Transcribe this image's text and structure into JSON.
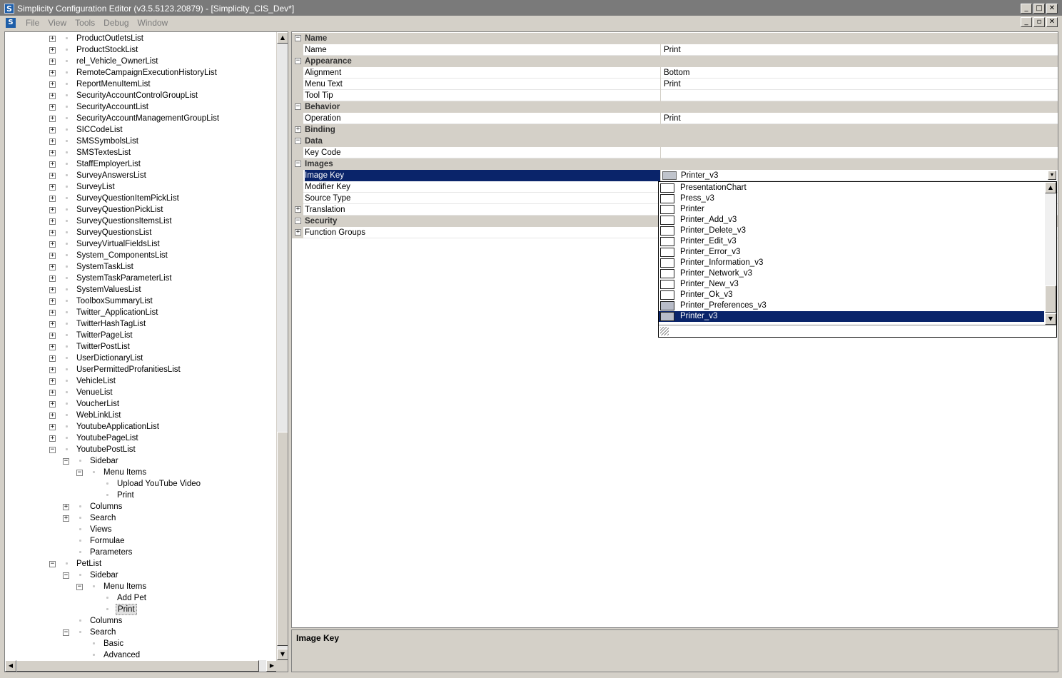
{
  "window": {
    "title": "Simplicity Configuration Editor (v3.5.5123.20879) - [Simplicity_CIS_Dev*]",
    "icon_letter": "S",
    "controls": [
      "_",
      "□",
      "✕"
    ],
    "mdi_controls": [
      "_",
      "▫",
      "✕"
    ]
  },
  "menu": [
    "File",
    "View",
    "Tools",
    "Debug",
    "Window"
  ],
  "tree": [
    {
      "label": "ProductOutletsList",
      "level": 0,
      "state": "collapsed"
    },
    {
      "label": "ProductStockList",
      "level": 0,
      "state": "collapsed"
    },
    {
      "label": "rel_Vehicle_OwnerList",
      "level": 0,
      "state": "collapsed"
    },
    {
      "label": "RemoteCampaignExecutionHistoryList",
      "level": 0,
      "state": "collapsed"
    },
    {
      "label": "ReportMenuItemList",
      "level": 0,
      "state": "collapsed"
    },
    {
      "label": "SecurityAccountControlGroupList",
      "level": 0,
      "state": "collapsed"
    },
    {
      "label": "SecurityAccountList",
      "level": 0,
      "state": "collapsed"
    },
    {
      "label": "SecurityAccountManagementGroupList",
      "level": 0,
      "state": "collapsed"
    },
    {
      "label": "SICCodeList",
      "level": 0,
      "state": "collapsed"
    },
    {
      "label": "SMSSymbolsList",
      "level": 0,
      "state": "collapsed"
    },
    {
      "label": "SMSTextesList",
      "level": 0,
      "state": "collapsed"
    },
    {
      "label": "StaffEmployerList",
      "level": 0,
      "state": "collapsed"
    },
    {
      "label": "SurveyAnswersList",
      "level": 0,
      "state": "collapsed"
    },
    {
      "label": "SurveyList",
      "level": 0,
      "state": "collapsed"
    },
    {
      "label": "SurveyQuestionItemPickList",
      "level": 0,
      "state": "collapsed"
    },
    {
      "label": "SurveyQuestionPickList",
      "level": 0,
      "state": "collapsed"
    },
    {
      "label": "SurveyQuestionsItemsList",
      "level": 0,
      "state": "collapsed"
    },
    {
      "label": "SurveyQuestionsList",
      "level": 0,
      "state": "collapsed"
    },
    {
      "label": "SurveyVirtualFieldsList",
      "level": 0,
      "state": "collapsed"
    },
    {
      "label": "System_ComponentsList",
      "level": 0,
      "state": "collapsed"
    },
    {
      "label": "SystemTaskList",
      "level": 0,
      "state": "collapsed"
    },
    {
      "label": "SystemTaskParameterList",
      "level": 0,
      "state": "collapsed"
    },
    {
      "label": "SystemValuesList",
      "level": 0,
      "state": "collapsed"
    },
    {
      "label": "ToolboxSummaryList",
      "level": 0,
      "state": "collapsed"
    },
    {
      "label": "Twitter_ApplicationList",
      "level": 0,
      "state": "collapsed"
    },
    {
      "label": "TwitterHashTagList",
      "level": 0,
      "state": "collapsed"
    },
    {
      "label": "TwitterPageList",
      "level": 0,
      "state": "collapsed"
    },
    {
      "label": "TwitterPostList",
      "level": 0,
      "state": "collapsed"
    },
    {
      "label": "UserDictionaryList",
      "level": 0,
      "state": "collapsed"
    },
    {
      "label": "UserPermittedProfanitiesList",
      "level": 0,
      "state": "collapsed"
    },
    {
      "label": "VehicleList",
      "level": 0,
      "state": "collapsed"
    },
    {
      "label": "VenueList",
      "level": 0,
      "state": "collapsed"
    },
    {
      "label": "VoucherList",
      "level": 0,
      "state": "collapsed"
    },
    {
      "label": "WebLinkList",
      "level": 0,
      "state": "collapsed"
    },
    {
      "label": "YoutubeApplicationList",
      "level": 0,
      "state": "collapsed"
    },
    {
      "label": "YoutubePageList",
      "level": 0,
      "state": "collapsed"
    },
    {
      "label": "YoutubePostList",
      "level": 0,
      "state": "expanded"
    },
    {
      "label": "Sidebar",
      "level": 1,
      "state": "expanded"
    },
    {
      "label": "Menu Items",
      "level": 2,
      "state": "expanded"
    },
    {
      "label": "Upload YouTube Video",
      "level": 3,
      "state": "leaf"
    },
    {
      "label": "Print",
      "level": 3,
      "state": "leaf"
    },
    {
      "label": "Columns",
      "level": 1,
      "state": "collapsed"
    },
    {
      "label": "Search",
      "level": 1,
      "state": "collapsed"
    },
    {
      "label": "Views",
      "level": 1,
      "state": "leaf"
    },
    {
      "label": "Formulae",
      "level": 1,
      "state": "leaf"
    },
    {
      "label": "Parameters",
      "level": 1,
      "state": "leaf"
    },
    {
      "label": "PetList",
      "level": 0,
      "state": "expanded"
    },
    {
      "label": "Sidebar",
      "level": 1,
      "state": "expanded"
    },
    {
      "label": "Menu Items",
      "level": 2,
      "state": "expanded"
    },
    {
      "label": "Add Pet",
      "level": 3,
      "state": "leaf"
    },
    {
      "label": "Print",
      "level": 3,
      "state": "leaf",
      "selected": true
    },
    {
      "label": "Columns",
      "level": 1,
      "state": "leaf"
    },
    {
      "label": "Search",
      "level": 1,
      "state": "expanded"
    },
    {
      "label": "Basic",
      "level": 2,
      "state": "leaf"
    },
    {
      "label": "Advanced",
      "level": 2,
      "state": "leaf"
    }
  ],
  "properties": [
    {
      "type": "category",
      "label": "Name",
      "state": "expanded"
    },
    {
      "type": "item",
      "name": "Name",
      "value": "Print"
    },
    {
      "type": "category",
      "label": "Appearance",
      "state": "expanded"
    },
    {
      "type": "item",
      "name": "Alignment",
      "value": "Bottom"
    },
    {
      "type": "item",
      "name": "Menu Text",
      "value": "Print"
    },
    {
      "type": "item",
      "name": "Tool Tip",
      "value": ""
    },
    {
      "type": "category",
      "label": "Behavior",
      "state": "expanded"
    },
    {
      "type": "item",
      "name": "Operation",
      "value": "Print"
    },
    {
      "type": "category",
      "label": "Binding",
      "state": "collapsed"
    },
    {
      "type": "category",
      "label": "Data",
      "state": "expanded"
    },
    {
      "type": "item",
      "name": "Key Code",
      "value": ""
    },
    {
      "type": "category",
      "label": "Images",
      "state": "expanded"
    },
    {
      "type": "item",
      "name": "Image Key",
      "value": "Printer_v3",
      "selected": true,
      "dropdown": true
    },
    {
      "type": "item",
      "name": "Modifier Key",
      "value": ""
    },
    {
      "type": "item",
      "name": "Source Type",
      "value": ""
    },
    {
      "type": "expandable",
      "name": "Translation",
      "state": "collapsed"
    },
    {
      "type": "category",
      "label": "Security",
      "state": "expanded"
    },
    {
      "type": "expandable",
      "name": "Function Groups",
      "state": "collapsed"
    }
  ],
  "dropdown": {
    "items": [
      {
        "label": "PresentationChart",
        "image": false
      },
      {
        "label": "Press_v3",
        "image": false
      },
      {
        "label": "Printer",
        "image": false
      },
      {
        "label": "Printer_Add_v3",
        "image": false
      },
      {
        "label": "Printer_Delete_v3",
        "image": false
      },
      {
        "label": "Printer_Edit_v3",
        "image": false
      },
      {
        "label": "Printer_Error_v3",
        "image": false
      },
      {
        "label": "Printer_Information_v3",
        "image": false
      },
      {
        "label": "Printer_Network_v3",
        "image": false
      },
      {
        "label": "Printer_New_v3",
        "image": false
      },
      {
        "label": "Printer_Ok_v3",
        "image": false
      },
      {
        "label": "Printer_Preferences_v3",
        "image": true
      },
      {
        "label": "Printer_v3",
        "image": true,
        "selected": true
      }
    ]
  },
  "description": {
    "title": "Image Key"
  }
}
